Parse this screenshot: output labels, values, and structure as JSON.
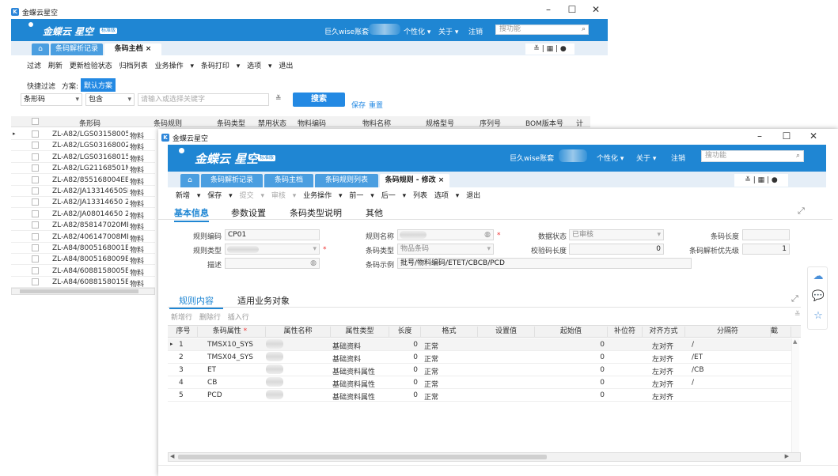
{
  "back_window": {
    "title": "金蝶云星空",
    "logo": "金蝶云 星空",
    "edition": "标准版",
    "header": {
      "account": "巨久wise账套",
      "personalize": "个性化",
      "about": "关于",
      "logout": "注销",
      "search_placeholder": "搜功能"
    },
    "tabs": [
      "条码解析记录",
      "条码主档"
    ],
    "toolbar": [
      "过滤",
      "刷新",
      "更新检验状态",
      "归档列表",
      "业务操作",
      "条码打印",
      "选项",
      "退出"
    ],
    "filter": {
      "quick": "快捷过滤",
      "scheme_label": "方案:",
      "scheme": "默认方案",
      "field": "条形码",
      "op": "包含",
      "placeholder": "请输入或选择关键字",
      "search": "搜索",
      "save": "保存",
      "reset": "重置"
    },
    "columns": [
      "条形码",
      "条码规则",
      "条码类型",
      "禁用状态",
      "物料编码",
      "物料名称",
      "规格型号",
      "序列号",
      "BOM版本号",
      "计"
    ],
    "rows": [
      "ZL-A82/LGS03158005EB/",
      "ZL-A82/LGS03168002EB/",
      "ZL-A82/LGS03168015EB/",
      "ZL-A82/LG21168501MB/I",
      "ZL-A82/855168004EB/ET",
      "ZL-A82/JA13314650SIML",
      "ZL-A82/JA13314650 2IML",
      "ZL-A82/JA08014650 2MB",
      "ZL-A82/858147020MB/ET",
      "ZL-A82/406147008MB/ET",
      "ZL-A84/8005168001EB/ET",
      "ZL-A84/8005168009EB/ET",
      "ZL-A84/6088158005EB/ET",
      "ZL-A84/6088158015EB/ET"
    ],
    "row_suffix": "物料"
  },
  "front_window": {
    "title": "金蝶云星空",
    "logo": "金蝶云 星空",
    "edition": "标准版",
    "header": {
      "account": "巨久wise账套",
      "personalize": "个性化",
      "about": "关于",
      "logout": "注销",
      "search_placeholder": "搜功能"
    },
    "tabs": [
      "条码解析记录",
      "条码主档",
      "条码规则列表",
      "条码规则 - 修改"
    ],
    "toolbar": [
      "新增",
      "保存",
      "提交",
      "审核",
      "业务操作",
      "前一",
      "后一",
      "列表",
      "选项",
      "退出"
    ],
    "section_tabs": [
      "基本信息",
      "参数设置",
      "条码类型说明",
      "其他"
    ],
    "form": {
      "rule_code_label": "规则编码",
      "rule_code": "CP01",
      "rule_type_label": "规则类型",
      "desc_label": "描述",
      "rule_name_label": "规则名称",
      "barcode_type_label": "条码类型",
      "barcode_type": "物品条码",
      "example_label": "条码示例",
      "example": "批号/物料编码/ETET/CBCB/PCD",
      "status_label": "数据状态",
      "status": "已审核",
      "check_len_label": "校验码长度",
      "check_len": "0",
      "barcode_len_label": "条码长度",
      "priority_label": "条码解析优先级",
      "priority": "1"
    },
    "sub_tabs": [
      "规则内容",
      "适用业务对象"
    ],
    "grid_toolbar": [
      "新增行",
      "删除行",
      "插入行"
    ],
    "columns": [
      "序号",
      "条码属性",
      "属性名称",
      "属性类型",
      "长度",
      "格式",
      "设置值",
      "起始值",
      "补位符",
      "对齐方式",
      "分隔符",
      "截"
    ],
    "rows": [
      {
        "no": "1",
        "attr": "TMSX10_SYS",
        "type": "基础资料",
        "len": "0",
        "fmt": "正常",
        "start": "0",
        "align": "左对齐",
        "sep": "/"
      },
      {
        "no": "2",
        "attr": "TMSX04_SYS",
        "type": "基础资料",
        "len": "0",
        "fmt": "正常",
        "start": "0",
        "align": "左对齐",
        "sep": "/ET"
      },
      {
        "no": "3",
        "attr": "ET",
        "type": "基础资料属性",
        "len": "0",
        "fmt": "正常",
        "start": "0",
        "align": "左对齐",
        "sep": "/CB"
      },
      {
        "no": "4",
        "attr": "CB",
        "type": "基础资料属性",
        "len": "0",
        "fmt": "正常",
        "start": "0",
        "align": "左对齐",
        "sep": "/"
      },
      {
        "no": "5",
        "attr": "PCD",
        "type": "基础资料属性",
        "len": "0",
        "fmt": "正常",
        "start": "0",
        "align": "左对齐",
        "sep": ""
      }
    ]
  }
}
